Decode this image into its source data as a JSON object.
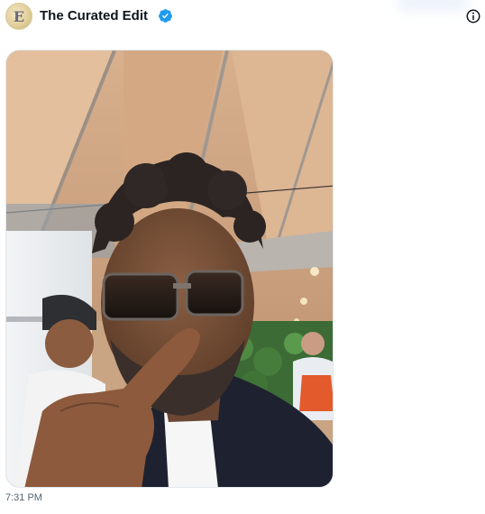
{
  "account": {
    "name": "The Curated Edit",
    "avatar_monogram": "E",
    "verified": true,
    "verified_icon": "verified-badge-icon",
    "verified_color": "#1d9bf0"
  },
  "actions": {
    "more_info_icon": "info-circle-icon"
  },
  "media": {
    "type": "photo",
    "icon": "selfie-photo"
  },
  "post": {
    "timestamp": "7:31 PM"
  }
}
